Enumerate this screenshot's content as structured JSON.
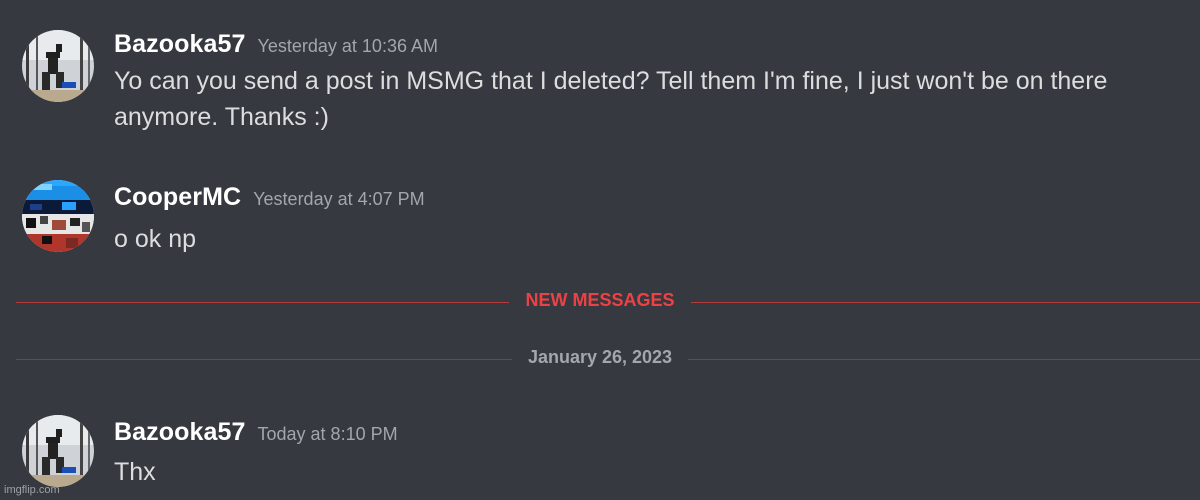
{
  "messages": [
    {
      "username": "Bazooka57",
      "timestamp": "Yesterday at 10:36 AM",
      "text": "Yo can you send a post in MSMG that I deleted? Tell them I'm fine, I just won't be on there anymore. Thanks :)",
      "avatar_icon": "user-avatar-photo"
    },
    {
      "username": "CooperMC",
      "timestamp": "Yesterday at 4:07 PM",
      "text": "o ok np",
      "avatar_icon": "user-avatar-pixel"
    },
    {
      "username": "Bazooka57",
      "timestamp": "Today at 8:10 PM",
      "text": "Thx",
      "avatar_icon": "user-avatar-photo"
    }
  ],
  "dividers": {
    "new_messages": "NEW MESSAGES",
    "date": "January 26, 2023"
  },
  "watermark": "imgflip.com",
  "colors": {
    "background": "#36393f",
    "username": "#ffffff",
    "timestamp": "#a3a6aa",
    "new_messages": "#ed4245",
    "message_text": "#dcddde"
  }
}
